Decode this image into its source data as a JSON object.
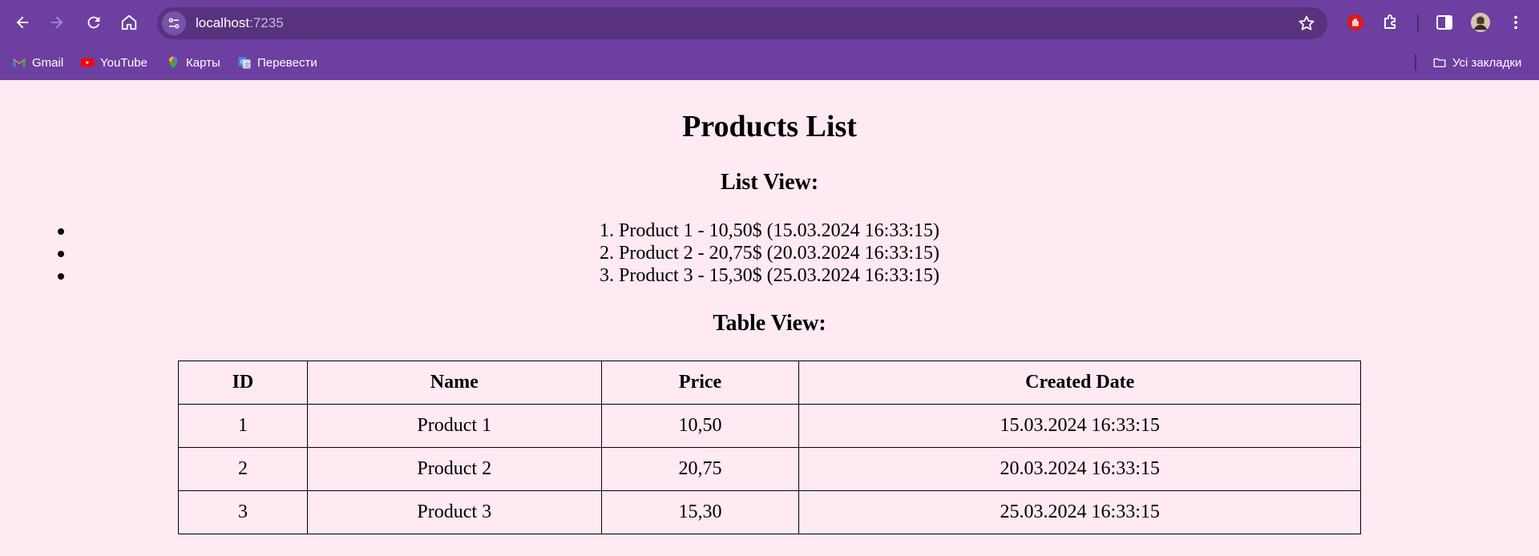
{
  "browser": {
    "url_host": "localhost",
    "url_port": ":7235",
    "bookmarks": [
      {
        "label": "Gmail",
        "icon": "gmail-icon"
      },
      {
        "label": "YouTube",
        "icon": "youtube-icon"
      },
      {
        "label": "Карты",
        "icon": "maps-icon"
      },
      {
        "label": "Перевести",
        "icon": "translate-icon"
      }
    ],
    "all_bookmarks_label": "Усі закладки",
    "colors": {
      "frame": "#6c3fa0",
      "omnibox": "#58327e",
      "page_background": "#ffe9f3"
    }
  },
  "page": {
    "title": "Products List",
    "list_heading": "List View:",
    "list_items": [
      "1. Product 1 - 10,50$ (15.03.2024 16:33:15)",
      "2. Product 2 - 20,75$ (20.03.2024 16:33:15)",
      "3. Product 3 - 15,30$ (25.03.2024 16:33:15)"
    ],
    "table_heading": "Table View:",
    "table": {
      "headers": [
        "ID",
        "Name",
        "Price",
        "Created Date"
      ],
      "rows": [
        [
          "1",
          "Product 1",
          "10,50",
          "15.03.2024 16:33:15"
        ],
        [
          "2",
          "Product 2",
          "20,75",
          "20.03.2024 16:33:15"
        ],
        [
          "3",
          "Product 3",
          "15,30",
          "25.03.2024 16:33:15"
        ]
      ]
    }
  }
}
